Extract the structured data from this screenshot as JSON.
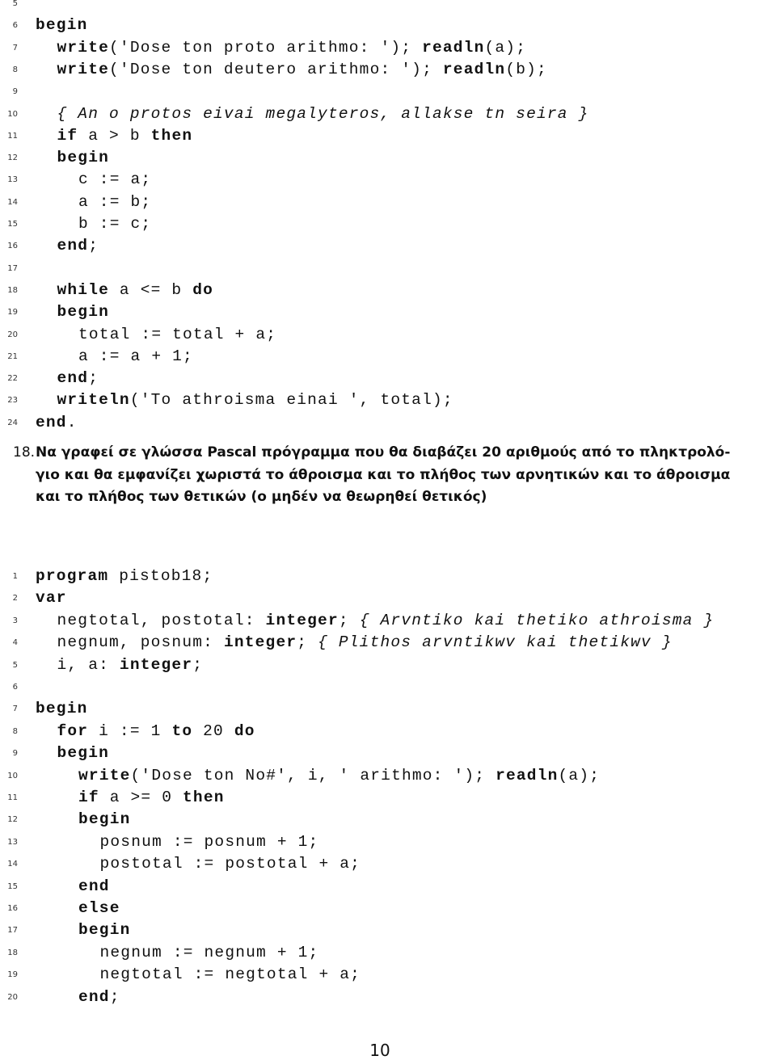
{
  "listing1": {
    "lines": [
      {
        "n": "5",
        "indent": 0,
        "tokens": []
      },
      {
        "n": "6",
        "indent": 0,
        "tokens": [
          {
            "t": "begin",
            "k": "kw"
          }
        ]
      },
      {
        "n": "7",
        "indent": 1,
        "tokens": [
          {
            "t": "write",
            "k": "kw"
          },
          {
            "t": "('Dose ton proto arithmo: '); ",
            "k": ""
          },
          {
            "t": "readln",
            "k": "kw"
          },
          {
            "t": "(a);",
            "k": ""
          }
        ]
      },
      {
        "n": "8",
        "indent": 1,
        "tokens": [
          {
            "t": "write",
            "k": "kw"
          },
          {
            "t": "('Dose ton deutero arithmo: '); ",
            "k": ""
          },
          {
            "t": "readln",
            "k": "kw"
          },
          {
            "t": "(b);",
            "k": ""
          }
        ]
      },
      {
        "n": "9",
        "indent": 0,
        "tokens": []
      },
      {
        "n": "10",
        "indent": 1,
        "tokens": [
          {
            "t": "{ An o protos eivai megalyteros, allakse tn seira }",
            "k": "cm"
          }
        ]
      },
      {
        "n": "11",
        "indent": 1,
        "tokens": [
          {
            "t": "if",
            "k": "kw"
          },
          {
            "t": " a > b ",
            "k": ""
          },
          {
            "t": "then",
            "k": "kw"
          }
        ]
      },
      {
        "n": "12",
        "indent": 1,
        "tokens": [
          {
            "t": "begin",
            "k": "kw"
          }
        ]
      },
      {
        "n": "13",
        "indent": 2,
        "tokens": [
          {
            "t": "c := a;",
            "k": ""
          }
        ]
      },
      {
        "n": "14",
        "indent": 2,
        "tokens": [
          {
            "t": "a := b;",
            "k": ""
          }
        ]
      },
      {
        "n": "15",
        "indent": 2,
        "tokens": [
          {
            "t": "b := c;",
            "k": ""
          }
        ]
      },
      {
        "n": "16",
        "indent": 1,
        "tokens": [
          {
            "t": "end",
            "k": "kw"
          },
          {
            "t": ";",
            "k": ""
          }
        ]
      },
      {
        "n": "17",
        "indent": 0,
        "tokens": []
      },
      {
        "n": "18",
        "indent": 1,
        "tokens": [
          {
            "t": "while",
            "k": "kw"
          },
          {
            "t": " a <= b ",
            "k": ""
          },
          {
            "t": "do",
            "k": "kw"
          }
        ]
      },
      {
        "n": "19",
        "indent": 1,
        "tokens": [
          {
            "t": "begin",
            "k": "kw"
          }
        ]
      },
      {
        "n": "20",
        "indent": 2,
        "tokens": [
          {
            "t": "total := total + a;",
            "k": ""
          }
        ]
      },
      {
        "n": "21",
        "indent": 2,
        "tokens": [
          {
            "t": "a := a + 1;",
            "k": ""
          }
        ]
      },
      {
        "n": "22",
        "indent": 1,
        "tokens": [
          {
            "t": "end",
            "k": "kw"
          },
          {
            "t": ";",
            "k": ""
          }
        ]
      },
      {
        "n": "23",
        "indent": 1,
        "tokens": [
          {
            "t": "writeln",
            "k": "kw"
          },
          {
            "t": "('To athroisma einai ', total);",
            "k": ""
          }
        ]
      },
      {
        "n": "24",
        "indent": 0,
        "tokens": [
          {
            "t": "end",
            "k": "kw"
          },
          {
            "t": ".",
            "k": ""
          }
        ]
      }
    ]
  },
  "question": {
    "number": "18.",
    "lines": [
      "Να γραφεί σε γλώσσα Pascal πρόγραμμα που θα διαβάζει 20 αριθμούς από το πληκτρολό-",
      "γιο και θα εμφανίζει χωριστά το άθροισμα και το πλήθος των αρνητικών και το άθροισμα",
      "και το πλήθος των θετικών (ο μηδέν να θεωρηθεί θετικός)"
    ]
  },
  "listing2": {
    "lines": [
      {
        "n": "1",
        "indent": 0,
        "tokens": [
          {
            "t": "program",
            "k": "kw"
          },
          {
            "t": " pistob18;",
            "k": ""
          }
        ]
      },
      {
        "n": "2",
        "indent": 0,
        "tokens": [
          {
            "t": "var",
            "k": "kw"
          }
        ]
      },
      {
        "n": "3",
        "indent": 1,
        "tokens": [
          {
            "t": "negtotal, postotal: ",
            "k": ""
          },
          {
            "t": "integer",
            "k": "kw"
          },
          {
            "t": "; ",
            "k": ""
          },
          {
            "t": "{ Arvntiko kai thetiko athroisma }",
            "k": "cm"
          }
        ]
      },
      {
        "n": "4",
        "indent": 1,
        "tokens": [
          {
            "t": "negnum, posnum: ",
            "k": ""
          },
          {
            "t": "integer",
            "k": "kw"
          },
          {
            "t": "; ",
            "k": ""
          },
          {
            "t": "{ Plithos arvntikwv kai thetikwv }",
            "k": "cm"
          }
        ]
      },
      {
        "n": "5",
        "indent": 1,
        "tokens": [
          {
            "t": "i, a: ",
            "k": ""
          },
          {
            "t": "integer",
            "k": "kw"
          },
          {
            "t": ";",
            "k": ""
          }
        ]
      },
      {
        "n": "6",
        "indent": 0,
        "tokens": []
      },
      {
        "n": "7",
        "indent": 0,
        "tokens": [
          {
            "t": "begin",
            "k": "kw"
          }
        ]
      },
      {
        "n": "8",
        "indent": 1,
        "tokens": [
          {
            "t": "for",
            "k": "kw"
          },
          {
            "t": " i := 1 ",
            "k": ""
          },
          {
            "t": "to",
            "k": "kw"
          },
          {
            "t": " 20 ",
            "k": ""
          },
          {
            "t": "do",
            "k": "kw"
          }
        ]
      },
      {
        "n": "9",
        "indent": 1,
        "tokens": [
          {
            "t": "begin",
            "k": "kw"
          }
        ]
      },
      {
        "n": "10",
        "indent": 2,
        "tokens": [
          {
            "t": "write",
            "k": "kw"
          },
          {
            "t": "('Dose ton No#', i, ' arithmo: '); ",
            "k": ""
          },
          {
            "t": "readln",
            "k": "kw"
          },
          {
            "t": "(a);",
            "k": ""
          }
        ]
      },
      {
        "n": "11",
        "indent": 2,
        "tokens": [
          {
            "t": "if",
            "k": "kw"
          },
          {
            "t": " a >= 0 ",
            "k": ""
          },
          {
            "t": "then",
            "k": "kw"
          }
        ]
      },
      {
        "n": "12",
        "indent": 2,
        "tokens": [
          {
            "t": "begin",
            "k": "kw"
          }
        ]
      },
      {
        "n": "13",
        "indent": 3,
        "tokens": [
          {
            "t": "posnum := posnum + 1;",
            "k": ""
          }
        ]
      },
      {
        "n": "14",
        "indent": 3,
        "tokens": [
          {
            "t": "postotal := postotal + a;",
            "k": ""
          }
        ]
      },
      {
        "n": "15",
        "indent": 2,
        "tokens": [
          {
            "t": "end",
            "k": "kw"
          }
        ]
      },
      {
        "n": "16",
        "indent": 2,
        "tokens": [
          {
            "t": "else",
            "k": "kw"
          }
        ]
      },
      {
        "n": "17",
        "indent": 2,
        "tokens": [
          {
            "t": "begin",
            "k": "kw"
          }
        ]
      },
      {
        "n": "18",
        "indent": 3,
        "tokens": [
          {
            "t": "negnum := negnum + 1;",
            "k": ""
          }
        ]
      },
      {
        "n": "19",
        "indent": 3,
        "tokens": [
          {
            "t": "negtotal := negtotal + a;",
            "k": ""
          }
        ]
      },
      {
        "n": "20",
        "indent": 2,
        "tokens": [
          {
            "t": "end",
            "k": "kw"
          },
          {
            "t": ";",
            "k": ""
          }
        ]
      }
    ]
  },
  "footer": {
    "page_number": "10"
  }
}
